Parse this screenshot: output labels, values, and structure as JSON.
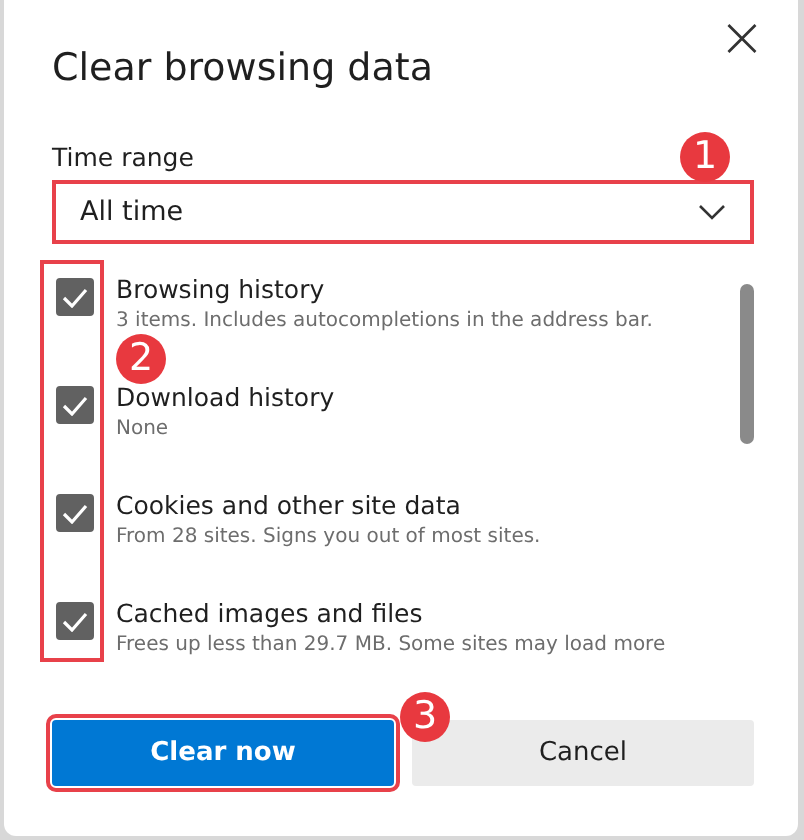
{
  "dialog": {
    "title": "Clear browsing data",
    "close": "×"
  },
  "time_range": {
    "label": "Time range",
    "value": "All time"
  },
  "items": [
    {
      "title": "Browsing history",
      "description": "3 items. Includes autocompletions in the address bar.",
      "checked": true
    },
    {
      "title": "Download history",
      "description": "None",
      "checked": true
    },
    {
      "title": "Cookies and other site data",
      "description": "From 28 sites. Signs you out of most sites.",
      "checked": true
    },
    {
      "title": "Cached images and files",
      "description": "Frees up less than 29.7 MB. Some sites may load more",
      "checked": true
    }
  ],
  "buttons": [
    {
      "label": "Clear now",
      "kind": "primary"
    },
    {
      "label": "Cancel",
      "kind": "secondary"
    }
  ],
  "annotations": [
    "1",
    "2",
    "3"
  ]
}
